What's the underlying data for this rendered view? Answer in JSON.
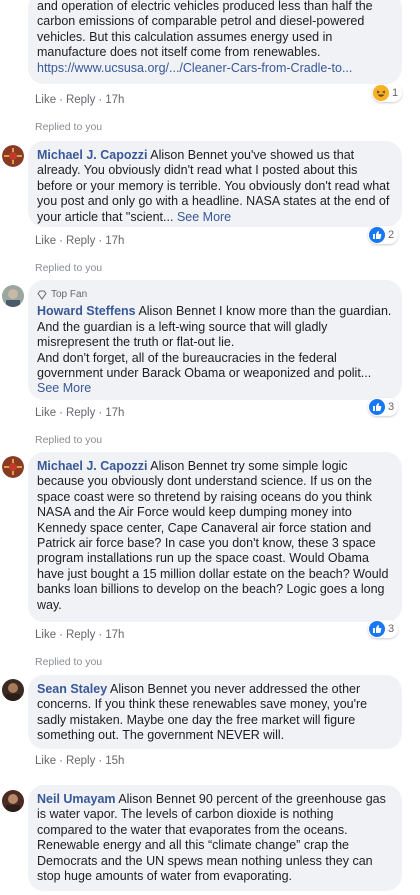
{
  "comments": [
    {
      "author": "",
      "text": "and operation of electric vehicles produced less than half the carbon emissions of comparable petrol and diesel-powered vehicles. But this calculation assumes energy used in manufacture does not itself come from renewables.",
      "link": "https://www.ucsusa.org/.../Cleaner-Cars-from-Cradle-to...",
      "like_label": "Like",
      "reply_label": "Reply",
      "time": "17h",
      "reaction_icon": "haha-icon",
      "reaction_count": "1"
    },
    {
      "replied_label": "Replied to you",
      "author": "Michael J. Capozzi",
      "text": "Alison Bennet you've showed us that already. You obviously didn't read what I posted about this before or your memory is terrible. You obviously don't read what you post and only go with a headline. NASA states at the end of your article that \"scient...",
      "see_more": "See More",
      "like_label": "Like",
      "reply_label": "Reply",
      "time": "17h",
      "reaction_icon": "like-icon",
      "reaction_count": "2"
    },
    {
      "replied_label": "Replied to you",
      "badge": "Top Fan",
      "author": "Howard Steffens",
      "text": "Alison Bennet I know more than the guardian. And the guardian is a left-wing source that will gladly misrepresent the truth or flat-out lie.",
      "text2": "And don't forget, all of the bureaucracies in the federal government under Barack Obama or weaponized and polit...",
      "see_more": "See More",
      "like_label": "Like",
      "reply_label": "Reply",
      "time": "17h",
      "reaction_icon": "like-icon",
      "reaction_count": "3"
    },
    {
      "replied_label": "Replied to you",
      "author": "Michael J. Capozzi",
      "text": "Alison Bennet try some simple logic because you obviously dont understand science. If us on the space coast were so thretend by raising oceans do you think NASA and the Air Force would keep dumping money into Kennedy space center, Cape Canaveral air force station and Patrick air force base? In case you don't know, these 3 space program installations run up the space coast. Would Obama have just bought a 15 million dollar estate on the beach? Would banks loan billions to develop on the beach? Logic goes a long way.",
      "like_label": "Like",
      "reply_label": "Reply",
      "time": "17h",
      "reaction_icon": "like-icon",
      "reaction_count": "3"
    },
    {
      "replied_label": "Replied to you",
      "author": "Sean Staley",
      "text": "Alison Bennet you never addressed the other concerns. If you think these renewables save money, you're sadly mistaken. Maybe one day the free market will figure something out. The government NEVER will.",
      "like_label": "Like",
      "reply_label": "Reply",
      "time": "15h"
    },
    {
      "author": "Neil Umayam",
      "text": "Alison Bennet 90 percent of the greenhouse gas is water vapor. The levels of carbon dioxide is nothing compared to the water that evaporates from the oceans. Renewable energy and all this “climate change” crap the Democrats and the UN spews mean nothing unless they can stop huge amounts of water from evaporating."
    }
  ],
  "colors": {
    "bubble": "#f0f2f5",
    "author": "#385898",
    "like_blue": "#1877f2",
    "meta": "#65676b"
  }
}
